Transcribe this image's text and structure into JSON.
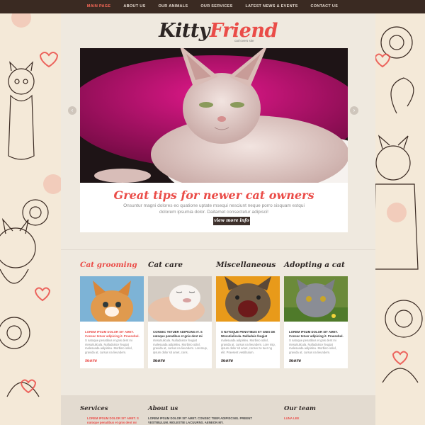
{
  "nav": {
    "items": [
      "MAIN PAGE",
      "ABOUT US",
      "OUR ANIMALS",
      "OUR SERVICES",
      "LATEST NEWS & EVENTS",
      "CONTACT US"
    ]
  },
  "logo": {
    "kitty": "Kitty",
    "friend": "Friend",
    "tagline": "cat lovers site"
  },
  "hero": {
    "title": "Great tips for newer cat owners",
    "text": "Onsuntur magni dolores eo quatione uptate msequi nesciunt neque porro sisquam estqui dolorem ipsumia dolor. Daitamet consectetur adipisci!",
    "button": "view more info"
  },
  "columns": [
    {
      "title": "Cat grooming",
      "head": "LOREM IPSUM DOLOR SIT AMET. Consec tetuer adipicing it. Praesebul.",
      "body": "S natoque penatibus et gnis dent mi ntesutiulicula. Nulladuisce feugiat malesuada adipisleu. Morbino odiol, gravida at, cursus na lieundem.",
      "more": "more"
    },
    {
      "title": "Cat care",
      "head": "CONSEC TETUER ADIPICING IT. S natoque penatibus et gnis dent mi",
      "body": "ntesutiulicula. Nulladuisce feugiat malesuada adipisleu. Morbino odiol, gravida at, cursus na lieundem. Loremup, ipsum dolor sit amet, cons.",
      "more": "more"
    },
    {
      "title": "Miscellaneous",
      "head": "S NATOQUE PENATIBUS ET GNIS DE Ntesutiulicula. Nulladuis feugiat",
      "body": "malesuada adipisleu. Morbino odiol, gravida at, cursus na lieundem. Lore mip, ipsum dolor sit amet, consec te tuer ng elit. Praesent vestibulum.",
      "more": "more"
    },
    {
      "title": "Adopting a cat",
      "head": "LOREM IPSUM DOLOR SIT AMET. Consec tetuer adipicing it. Praesebul.",
      "body": "S natoque penatibus et gnis dent mi ntesutiulicula. Nulladuisce feugiat malesuada adipisleu. Morbino odiol, gravida at, cursus na lieundem.",
      "more": "more"
    }
  ],
  "footer": {
    "services": {
      "title": "Services",
      "text": "LOREM IPSUM DOLOR SIT AMET. S natoque penatibus et gnis dent mi"
    },
    "about": {
      "title": "About us",
      "text": "LOREM IPSUM DOLOR SIT AMET. CONSEC TEER ADIPISCING. PREENT VESTIBULUM. MOLESTIE LACUURNS. AENEON MY."
    },
    "team": {
      "title": "Our team",
      "text": "LUNA LEE"
    }
  },
  "colors": {
    "accent": "#ea4c48",
    "nav_bg": "#3a2a22",
    "dark": "#2d2624"
  }
}
